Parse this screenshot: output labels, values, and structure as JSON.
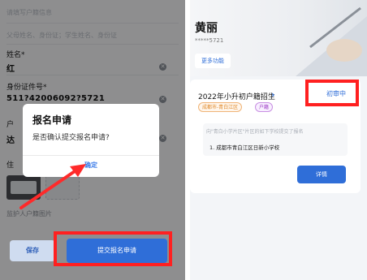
{
  "left": {
    "form": {
      "top_hint": "请填写户籍信息",
      "parent_hint": "父母姓名、身份证；学生姓名、身份证",
      "name_label": "姓名*",
      "name_value": "红",
      "id_label": "身份证件号*",
      "id_value": "511?42006092?5721",
      "hukou_label": "户",
      "address_value": "达",
      "photo_label": "住",
      "guardian_photo_label": "监护人户籍图片"
    },
    "dialog": {
      "title": "报名申请",
      "message": "是否确认提交报名申请?",
      "confirm_label": "确定"
    },
    "buttons": {
      "save_label": "保存",
      "submit_label": "提交报名申请"
    }
  },
  "right": {
    "profile": {
      "name": "黄丽",
      "phone": "*****5721",
      "more_label": "更多功能"
    },
    "enrollment": {
      "title": "2022年小升初户籍招生",
      "status": "初审中",
      "tags": [
        "成都市-青白江区",
        "户籍"
      ],
      "school_hint": "向\"青白小学片区\"片区的如下学校提交了报名",
      "school_value": "1. 成都市青白江区日新小学校",
      "detail_label": "详情"
    }
  },
  "colors": {
    "primary": "#2f6ed8",
    "highlight": "#ff2020"
  }
}
